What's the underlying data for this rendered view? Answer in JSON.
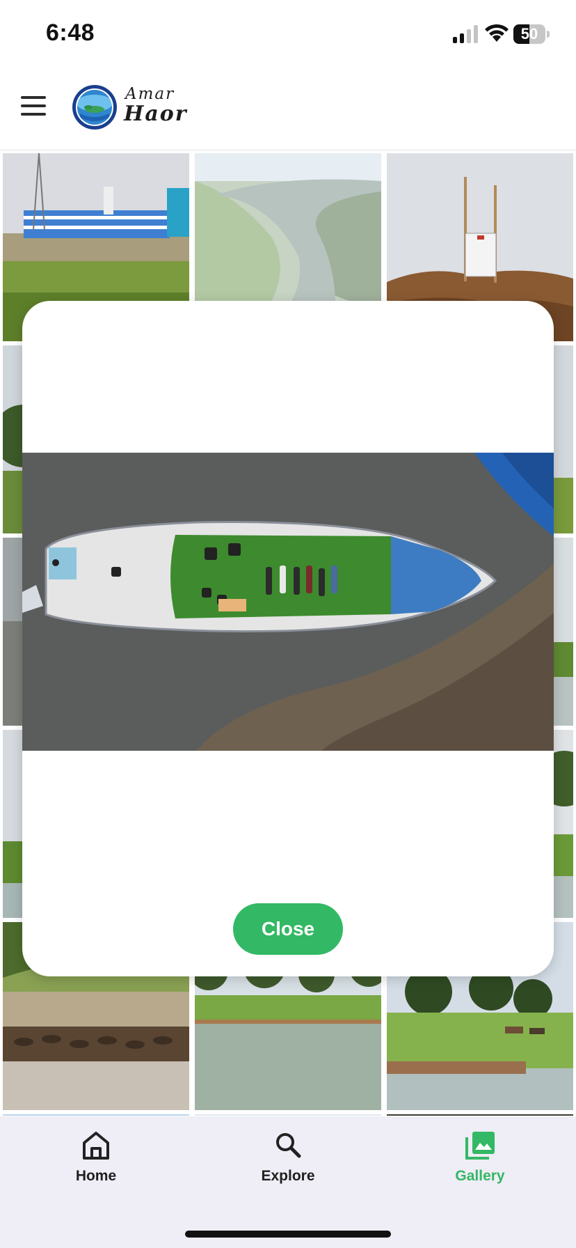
{
  "status_bar": {
    "time": "6:48",
    "battery": "50",
    "battery_level": 0.5,
    "icons": [
      "cellular-signal-icon",
      "wifi-icon",
      "battery-icon"
    ]
  },
  "header": {
    "menu_icon": "hamburger-menu-icon",
    "brand_line1": "Amar",
    "brand_line2": "Haor"
  },
  "gallery": {
    "tiles": [
      {
        "scene": "building-with-tower"
      },
      {
        "scene": "aerial-river-bend"
      },
      {
        "scene": "signboard-on-soil"
      },
      {
        "scene": "tree-green-field"
      },
      {
        "scene": "field-water"
      },
      {
        "scene": "field-water"
      },
      {
        "scene": "field-water"
      },
      {
        "scene": "tree-green-field"
      },
      {
        "scene": "field-water"
      },
      {
        "scene": "ducks-on-shore"
      },
      {
        "scene": "trees-lakeside"
      },
      {
        "scene": "cattle-lakeside"
      }
    ]
  },
  "modal": {
    "image_scene": "aerial-boat-on-water",
    "close_label": "Close"
  },
  "bottom_nav": {
    "items": [
      {
        "label": "Home",
        "icon": "home-icon",
        "active": false
      },
      {
        "label": "Explore",
        "icon": "search-icon",
        "active": false
      },
      {
        "label": "Gallery",
        "icon": "gallery-icon",
        "active": true
      }
    ]
  },
  "colors": {
    "accent": "#33b865",
    "nav_background": "#efedf5",
    "modal_background": "#ffffff"
  }
}
